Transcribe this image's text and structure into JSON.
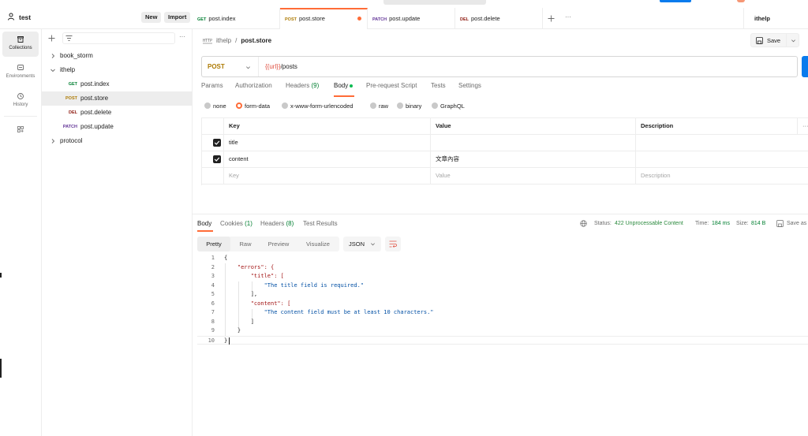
{
  "workspace": {
    "name": "test",
    "new_label": "New",
    "import_label": "Import"
  },
  "rail": {
    "items": [
      {
        "label": "Collections",
        "icon": "collections-icon"
      },
      {
        "label": "Environments",
        "icon": "environments-icon"
      },
      {
        "label": "History",
        "icon": "history-icon"
      },
      {
        "label": "",
        "icon": "apps-icon"
      }
    ]
  },
  "tree": {
    "items": [
      {
        "label": "book_storm",
        "method": ""
      },
      {
        "label": "ithelp",
        "method": ""
      },
      {
        "label": "post.index",
        "method": "GET"
      },
      {
        "label": "post.store",
        "method": "POST"
      },
      {
        "label": "post.delete",
        "method": "DEL"
      },
      {
        "label": "post.update",
        "method": "PATCH"
      },
      {
        "label": "protocol",
        "method": ""
      }
    ]
  },
  "tabs": [
    {
      "method": "GET",
      "label": "post.index"
    },
    {
      "method": "POST",
      "label": "post.store"
    },
    {
      "method": "PATCH",
      "label": "post.update"
    },
    {
      "method": "DEL",
      "label": "post.delete"
    }
  ],
  "environment": {
    "label": "ithelp"
  },
  "breadcrumb": {
    "parent": "ithelp",
    "separator": "/",
    "current": "post.store"
  },
  "save_label": "Save",
  "request": {
    "method": "POST",
    "url_var": "{{url}}",
    "url_path": "/posts"
  },
  "req_tabs": {
    "params": "Params",
    "authorization": "Authorization",
    "headers": "Headers",
    "headers_count": "(9)",
    "body": "Body",
    "prerequest": "Pre-request Script",
    "tests": "Tests",
    "settings": "Settings"
  },
  "body_modes": {
    "none": "none",
    "form_data": "form-data",
    "urlencoded": "x-www-form-urlencoded",
    "raw": "raw",
    "binary": "binary",
    "graphql": "GraphQL"
  },
  "params_table": {
    "headers": {
      "key": "Key",
      "value": "Value",
      "description": "Description",
      "more": "···"
    },
    "rows": [
      {
        "key": "title",
        "value": "",
        "description": ""
      },
      {
        "key": "content",
        "value": "文章內容",
        "description": ""
      }
    ],
    "placeholder": {
      "key": "Key",
      "value": "Value",
      "description": "Description"
    }
  },
  "response": {
    "tabs": {
      "body": "Body",
      "cookies": "Cookies",
      "cookies_count": "(1)",
      "headers": "Headers",
      "headers_count": "(8)",
      "test_results": "Test Results"
    },
    "status_label": "Status:",
    "status_value": "422 Unprocessable Content",
    "time_label": "Time:",
    "time_value": "184 ms",
    "size_label": "Size:",
    "size_value": "814 B",
    "save_as": "Save as",
    "views": {
      "pretty": "Pretty",
      "raw": "Raw",
      "preview": "Preview",
      "visualize": "Visualize"
    },
    "format": "JSON",
    "code_lines": [
      {
        "n": "1",
        "text": "{"
      },
      {
        "n": "2",
        "text": "    \"errors\": {"
      },
      {
        "n": "3",
        "text": "        \"title\": ["
      },
      {
        "n": "4",
        "text": "            \"The title field is required.\""
      },
      {
        "n": "5",
        "text": "        ],"
      },
      {
        "n": "6",
        "text": "        \"content\": ["
      },
      {
        "n": "7",
        "text": "            \"The content field must be at least 10 characters.\""
      },
      {
        "n": "8",
        "text": "        ]"
      },
      {
        "n": "9",
        "text": "    }"
      },
      {
        "n": "10",
        "text": "}"
      }
    ]
  },
  "colors": {
    "accent": "#ff6c37",
    "send": "#097bed",
    "get": "#007f31",
    "post": "#ad7a03",
    "delete": "#8e1a10",
    "patch": "#623497"
  }
}
